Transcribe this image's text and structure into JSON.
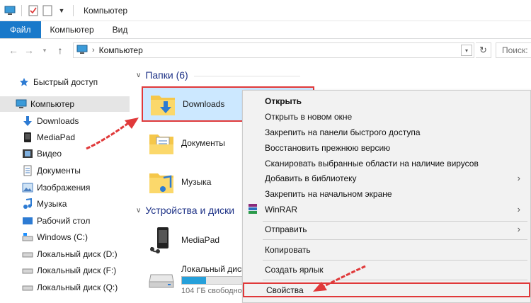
{
  "window": {
    "title": "Компьютер"
  },
  "ribbon": {
    "tabs": [
      "Файл",
      "Компьютер",
      "Вид"
    ]
  },
  "address": {
    "crumb": "Компьютер",
    "search_placeholder": "Поиск:"
  },
  "nav": {
    "quick_access": "Быстрый доступ",
    "computer": "Компьютер",
    "items": [
      "Downloads",
      "MediaPad",
      "Видео",
      "Документы",
      "Изображения",
      "Музыка",
      "Рабочий стол",
      "Windows (C:)",
      "Локальный диск (D:)",
      "Локальный диск (F:)",
      "Локальный диск (Q:)"
    ]
  },
  "content": {
    "folders_header": "Папки (6)",
    "folders": [
      "Downloads",
      "Документы",
      "Музыка"
    ],
    "devices_header": "Устройства и диски",
    "devices": [
      {
        "name": "MediaPad"
      },
      {
        "name": "Локальный диск",
        "free": "104 ГБ свободно",
        "usage_fraction": 0.35
      }
    ]
  },
  "context_menu": {
    "items": [
      "Открыть",
      "Открыть в новом окне",
      "Закрепить на панели быстрого доступа",
      "Восстановить прежнюю версию",
      "Сканировать выбранные области на наличие вирусов",
      "Добавить в библиотеку",
      "Закрепить на начальном экране",
      "WinRAR",
      "Отправить",
      "Копировать",
      "Создать ярлык",
      "Свойства"
    ]
  },
  "colors": {
    "accent": "#1979ca",
    "highlight": "#e0393a",
    "selection": "#cce8ff"
  }
}
